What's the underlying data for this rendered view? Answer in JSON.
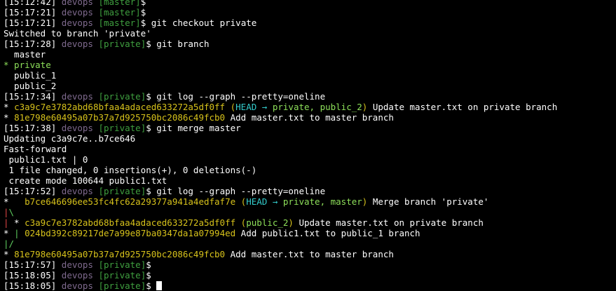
{
  "colors": {
    "background": "#000000",
    "text": "#ffffff",
    "user": "#7f6a8e",
    "branch_prompt": "#3f9f3f",
    "current_branch": "#8ee05a",
    "commit_hash": "#d7c21b",
    "head_ref": "#33cccc",
    "graph_red": "#e04646",
    "graph_green": "#60d060"
  },
  "lines": [
    {
      "type": "prompt",
      "ts": "[15:12:42]",
      "user": "devops",
      "branch": "[master]",
      "cmd": "$"
    },
    {
      "type": "prompt",
      "ts": "[15:17:21]",
      "user": "devops",
      "branch": "[master]",
      "cmd": "$"
    },
    {
      "type": "prompt",
      "ts": "[15:17:21]",
      "user": "devops",
      "branch": "[master]",
      "cmd": "$ git checkout private"
    },
    {
      "type": "output",
      "text": "Switched to branch 'private'"
    },
    {
      "type": "prompt",
      "ts": "[15:17:28]",
      "user": "devops",
      "branch": "[private]",
      "cmd": "$ git branch"
    },
    {
      "type": "output",
      "text": "  master"
    },
    {
      "type": "current",
      "text": "* private"
    },
    {
      "type": "output",
      "text": "  public_1"
    },
    {
      "type": "output",
      "text": "  public_2"
    },
    {
      "type": "prompt",
      "ts": "[15:17:34]",
      "user": "devops",
      "branch": "[private]",
      "cmd": "$ git log --graph --pretty=oneline"
    },
    {
      "type": "commit",
      "graph": "* ",
      "graph_color": "white",
      "hash": "c3a9c7e3782abd68bfaa4adaced633272a5df0ff",
      "head": "HEAD",
      "arrow": " → ",
      "refs": "private, public_2",
      "msg": " Update master.txt on private branch"
    },
    {
      "type": "commit",
      "graph": "* ",
      "graph_color": "white",
      "hash": "81e798e60495a07b37a7d925750bc2086c49fcb0",
      "head": "",
      "arrow": "",
      "refs": "",
      "msg": " Add master.txt to master branch"
    },
    {
      "type": "prompt",
      "ts": "[15:17:38]",
      "user": "devops",
      "branch": "[private]",
      "cmd": "$ git merge master"
    },
    {
      "type": "output",
      "text": "Updating c3a9c7e..b7ce646"
    },
    {
      "type": "output",
      "text": "Fast-forward"
    },
    {
      "type": "output",
      "text": " public1.txt | 0"
    },
    {
      "type": "output",
      "text": " 1 file changed, 0 insertions(+), 0 deletions(-)"
    },
    {
      "type": "output",
      "text": " create mode 100644 public1.txt"
    },
    {
      "type": "prompt",
      "ts": "[15:17:52]",
      "user": "devops",
      "branch": "[private]",
      "cmd": "$ git log --graph --pretty=oneline"
    },
    {
      "type": "commit",
      "graph": "*   ",
      "graph_color": "white",
      "hash": "b7ce646696ee53fc4fc62a29377a941a4edfaf7e",
      "head": "HEAD",
      "arrow": " → ",
      "refs": "private, master",
      "msg": " Merge branch 'private'"
    },
    {
      "type": "graph",
      "parts": [
        {
          "t": "|",
          "c": "red"
        },
        {
          "t": "\\",
          "c": "green"
        }
      ]
    },
    {
      "type": "commit2",
      "lead": "|",
      "lead_color": "red",
      "graph": " * ",
      "hash": "c3a9c7e3782abd68bfaa4adaced633272a5df0ff",
      "refs": "public_2",
      "msg": " Update master.txt on private branch"
    },
    {
      "type": "commit3",
      "graph": "* ",
      "pipe": "|",
      "pipe_color": "green",
      "hash": "024bd392c89217de7a99e87ba0347da1a07994ed",
      "msg": " Add public1.txt to public_1 branch"
    },
    {
      "type": "graph",
      "parts": [
        {
          "t": "|",
          "c": "green"
        },
        {
          "t": "/",
          "c": "green"
        }
      ]
    },
    {
      "type": "commit",
      "graph": "* ",
      "graph_color": "white",
      "hash": "81e798e60495a07b37a7d925750bc2086c49fcb0",
      "head": "",
      "arrow": "",
      "refs": "",
      "msg": " Add master.txt to master branch"
    },
    {
      "type": "prompt",
      "ts": "[15:17:57]",
      "user": "devops",
      "branch": "[private]",
      "cmd": "$"
    },
    {
      "type": "prompt",
      "ts": "[15:18:05]",
      "user": "devops",
      "branch": "[private]",
      "cmd": "$"
    },
    {
      "type": "prompt",
      "ts": "[15:18:05]",
      "user": "devops",
      "branch": "[private]",
      "cmd": "$ ",
      "cursor": true
    }
  ]
}
